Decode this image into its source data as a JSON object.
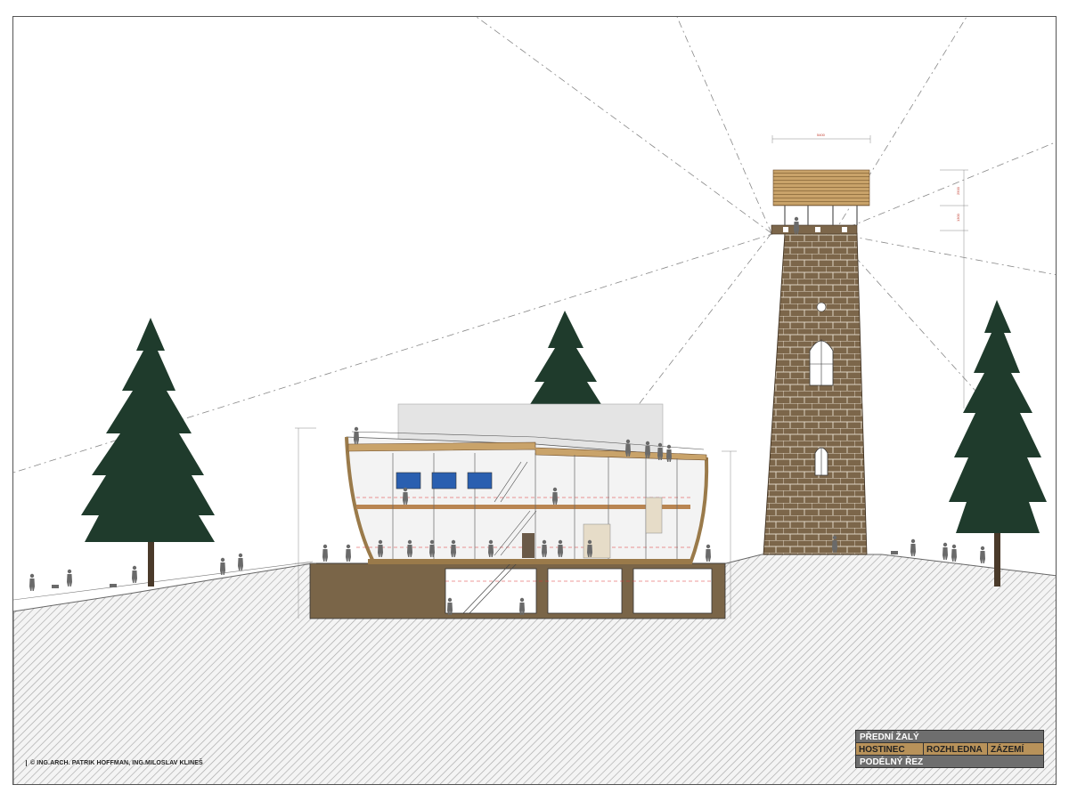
{
  "drawing": {
    "credit": "© ING.ARCH. PATRIK HOFFMAN, ING.MILOSLAV KLINEŠ",
    "title_block": {
      "project": "PŘEDNÍ ŽALÝ",
      "sections": [
        "HOSTINEC",
        "ROZHLEDNA",
        "ZÁZEMÍ"
      ],
      "sheet": "PODÉLNÝ ŘEZ"
    },
    "dimensions": {
      "tower_width": "5400",
      "roof_height": "2500",
      "parapet_height": "1300"
    }
  },
  "colors": {
    "earth": "#7a6548",
    "ground_hatch": "#b9b9b9",
    "tower": "#7c664a",
    "tree": "#1f3b2c",
    "title_bg": "#6e6e6e",
    "title_accent": "#b8925a"
  }
}
